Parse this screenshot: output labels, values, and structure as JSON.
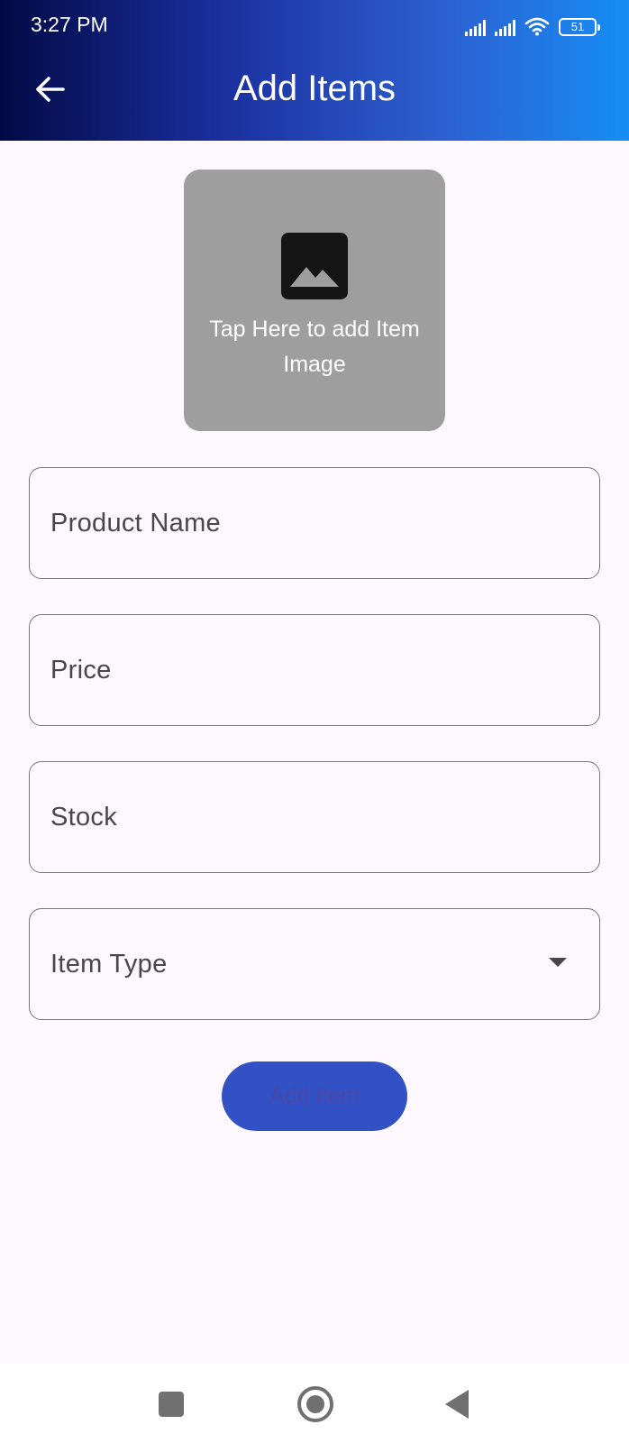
{
  "status_bar": {
    "time": "3:27 PM",
    "battery": "51",
    "icons": [
      "signal-icon",
      "signal-icon",
      "wifi-icon",
      "battery-icon"
    ]
  },
  "header": {
    "title": "Add Items",
    "back_icon": "arrow-left-icon",
    "gradient": [
      "#020a45",
      "#1b2f9e",
      "#2d5fd0",
      "#168df5"
    ]
  },
  "image_picker": {
    "label": "Tap Here to add Item Image",
    "icon": "image-icon",
    "background": "#9e9e9e"
  },
  "form": {
    "product_name_label": "Product Name",
    "price_label": "Price",
    "stock_label": "Stock",
    "item_type_label": "Item Type",
    "item_type_icon": "dropdown-arrow-icon"
  },
  "actions": {
    "add_item_label": "Add Item",
    "button_color": "#3251c4"
  },
  "nav_bar": {
    "icons": [
      "recents-square-icon",
      "home-circle-icon",
      "back-triangle-icon"
    ]
  }
}
